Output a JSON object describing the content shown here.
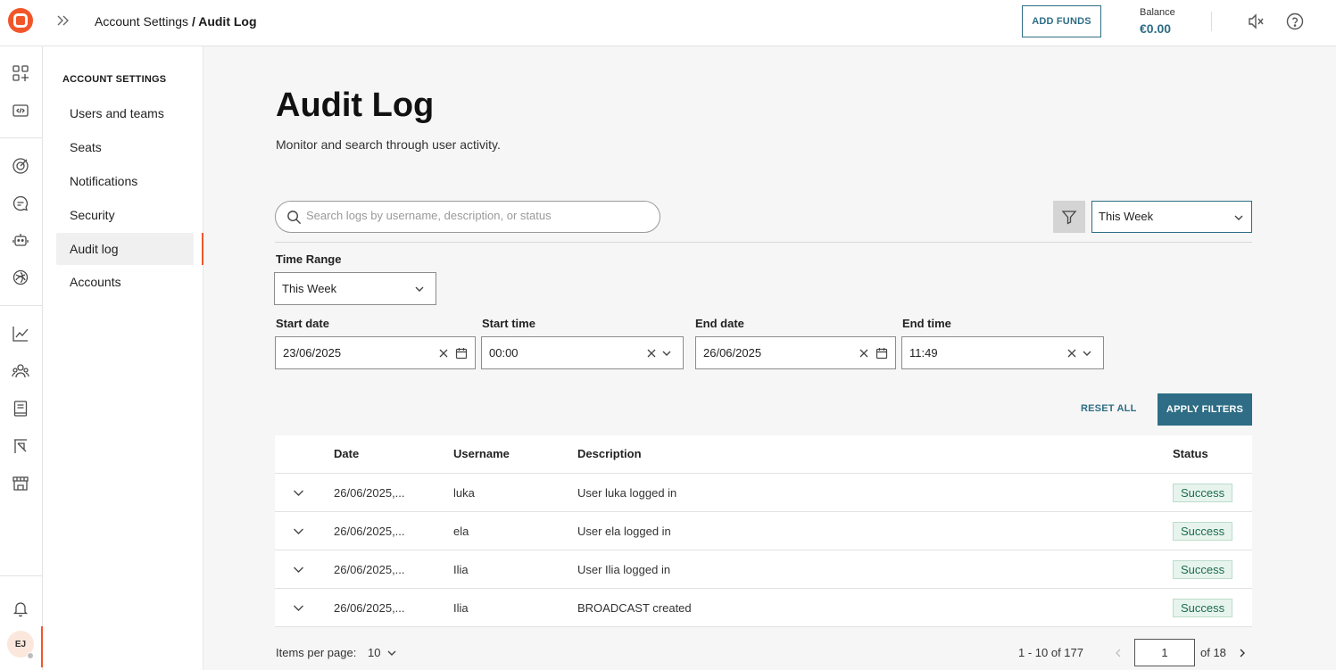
{
  "topbar": {
    "breadcrumb_parent": "Account Settings",
    "breadcrumb_sep": " / ",
    "breadcrumb_current": "Audit Log",
    "add_funds": "ADD FUNDS",
    "balance_label": "Balance",
    "balance_value": "€0.00",
    "icons": [
      "logo-icon",
      "expand-icon",
      "mute-icon",
      "help-icon"
    ]
  },
  "rail": {
    "icons": [
      "apps-icon",
      "code-icon",
      "target-icon",
      "chat-icon",
      "bot-icon",
      "ai-icon",
      "chart-icon",
      "team-icon",
      "book-icon",
      "import-icon",
      "store-icon",
      "bell-icon"
    ],
    "avatar_initials": "EJ"
  },
  "sidebar": {
    "heading": "ACCOUNT SETTINGS",
    "items": [
      {
        "label": "Users and teams"
      },
      {
        "label": "Seats"
      },
      {
        "label": "Notifications"
      },
      {
        "label": "Security"
      },
      {
        "label": "Audit log"
      },
      {
        "label": "Accounts"
      }
    ],
    "active_index": 4
  },
  "page": {
    "title": "Audit Log",
    "subtitle": "Monitor and search through user activity."
  },
  "search": {
    "placeholder": "Search logs by username, description, or status",
    "value": ""
  },
  "range_select": {
    "value": "This Week"
  },
  "filters": {
    "time_range_label": "Time Range",
    "time_range_value": "This Week",
    "start_date_label": "Start date",
    "start_date_value": "23/06/2025",
    "start_time_label": "Start time",
    "start_time_value": "00:00",
    "end_date_label": "End date",
    "end_date_value": "26/06/2025",
    "end_time_label": "End time",
    "end_time_value": "11:49",
    "reset_label": "RESET ALL",
    "apply_label": "APPLY FILTERS"
  },
  "table": {
    "columns": [
      "Date",
      "Username",
      "Description",
      "Status"
    ],
    "rows": [
      {
        "date": "26/06/2025,...",
        "username": "luka",
        "description": "User luka logged in",
        "status": "Success"
      },
      {
        "date": "26/06/2025,...",
        "username": "ela",
        "description": "User ela logged in",
        "status": "Success"
      },
      {
        "date": "26/06/2025,...",
        "username": "Ilia",
        "description": "User Ilia logged in",
        "status": "Success"
      },
      {
        "date": "26/06/2025,...",
        "username": "Ilia",
        "description": "BROADCAST created",
        "status": "Success"
      }
    ]
  },
  "pagination": {
    "items_per_page_label": "Items per page:",
    "items_per_page": "10",
    "range_text": "1 - 10 of 177",
    "current_page": "1",
    "of_pages": "of 18"
  },
  "colors": {
    "accent": "#2e6d85",
    "brand": "#f1562a",
    "success_bg": "#e7f4ee",
    "success_text": "#1b6b4c"
  }
}
